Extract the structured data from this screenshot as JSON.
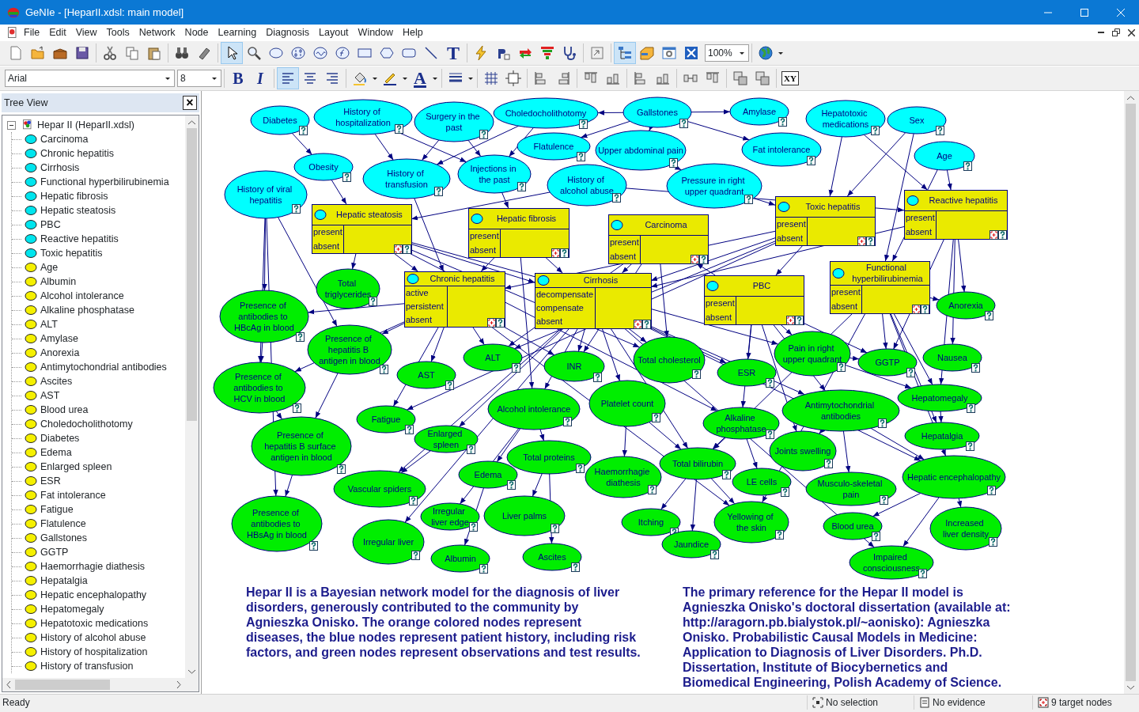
{
  "window": {
    "title": "GeNIe - [HeparII.xdsl: main model]"
  },
  "menu": [
    "File",
    "Edit",
    "View",
    "Tools",
    "Network",
    "Node",
    "Learning",
    "Diagnosis",
    "Layout",
    "Window",
    "Help"
  ],
  "toolbar": {
    "font": "Arial",
    "font_size": "8",
    "zoom": "100%",
    "text_tool": "T",
    "bold": "B",
    "italic": "I",
    "font_color": "A",
    "xy": "XY",
    "pressed": {
      "pointer": true,
      "tree_view": true,
      "align_left": true
    }
  },
  "tree_view": {
    "title": "Tree View",
    "close": "×",
    "root": "Hepar II (HeparII.xdsl)",
    "expanded": true,
    "items": [
      {
        "label": "Carcinoma",
        "kind": "disease"
      },
      {
        "label": "Chronic hepatitis",
        "kind": "disease"
      },
      {
        "label": "Cirrhosis",
        "kind": "disease"
      },
      {
        "label": "Functional hyperbilirubinemia",
        "kind": "disease"
      },
      {
        "label": "Hepatic fibrosis",
        "kind": "disease"
      },
      {
        "label": "Hepatic steatosis",
        "kind": "disease"
      },
      {
        "label": "PBC",
        "kind": "disease"
      },
      {
        "label": "Reactive hepatitis",
        "kind": "disease"
      },
      {
        "label": "Toxic hepatitis",
        "kind": "disease"
      },
      {
        "label": "Age",
        "kind": "variable"
      },
      {
        "label": "Albumin",
        "kind": "variable"
      },
      {
        "label": "Alcohol intolerance",
        "kind": "variable"
      },
      {
        "label": "Alkaline phosphatase",
        "kind": "variable"
      },
      {
        "label": "ALT",
        "kind": "variable"
      },
      {
        "label": "Amylase",
        "kind": "variable"
      },
      {
        "label": "Anorexia",
        "kind": "variable"
      },
      {
        "label": "Antimytochondrial antibodies",
        "kind": "variable"
      },
      {
        "label": "Ascites",
        "kind": "variable"
      },
      {
        "label": "AST",
        "kind": "variable"
      },
      {
        "label": "Blood urea",
        "kind": "variable"
      },
      {
        "label": "Choledocholithotomy",
        "kind": "variable"
      },
      {
        "label": "Diabetes",
        "kind": "variable"
      },
      {
        "label": "Edema",
        "kind": "variable"
      },
      {
        "label": "Enlarged spleen",
        "kind": "variable"
      },
      {
        "label": "ESR",
        "kind": "variable"
      },
      {
        "label": "Fat intolerance",
        "kind": "variable"
      },
      {
        "label": "Fatigue",
        "kind": "variable"
      },
      {
        "label": "Flatulence",
        "kind": "variable"
      },
      {
        "label": "Gallstones",
        "kind": "variable"
      },
      {
        "label": "GGTP",
        "kind": "variable"
      },
      {
        "label": "Haemorrhagie diathesis",
        "kind": "variable"
      },
      {
        "label": "Hepatalgia",
        "kind": "variable"
      },
      {
        "label": "Hepatic encephalopathy",
        "kind": "variable"
      },
      {
        "label": "Hepatomegaly",
        "kind": "variable"
      },
      {
        "label": "Hepatotoxic medications",
        "kind": "variable"
      },
      {
        "label": "History of alcohol abuse",
        "kind": "variable"
      },
      {
        "label": "History of hospitalization",
        "kind": "variable"
      },
      {
        "label": "History of transfusion",
        "kind": "variable"
      }
    ]
  },
  "network": {
    "nodes": [
      {
        "label": "Diabetes",
        "kind": "history"
      },
      {
        "label": "History of\nhospitalization",
        "kind": "history"
      },
      {
        "label": "Surgery in the\npast",
        "kind": "history"
      },
      {
        "label": "Choledocholithotomy",
        "kind": "history"
      },
      {
        "label": "Gallstones",
        "kind": "history"
      },
      {
        "label": "Amylase",
        "kind": "history"
      },
      {
        "label": "Hepatotoxic\nmedications",
        "kind": "history"
      },
      {
        "label": "Sex",
        "kind": "history"
      },
      {
        "label": "Flatulence",
        "kind": "history"
      },
      {
        "label": "Upper abdominal pain",
        "kind": "history"
      },
      {
        "label": "Fat intolerance",
        "kind": "history"
      },
      {
        "label": "Age",
        "kind": "history"
      },
      {
        "label": "Obesity",
        "kind": "history"
      },
      {
        "label": "History of\ntransfusion",
        "kind": "history"
      },
      {
        "label": "Injections in\nthe past",
        "kind": "history"
      },
      {
        "label": "History of\nalcohol abuse",
        "kind": "history"
      },
      {
        "label": "Pressure in right\nupper quadrant",
        "kind": "history"
      },
      {
        "label": "History of viral\nhepatitis",
        "kind": "history"
      },
      {
        "label": "Hepatic steatosis",
        "kind": "disease",
        "target": true,
        "states": [
          "present",
          "absent"
        ]
      },
      {
        "label": "Hepatic fibrosis",
        "kind": "disease",
        "target": true,
        "states": [
          "present",
          "absent"
        ]
      },
      {
        "label": "Carcinoma",
        "kind": "disease",
        "target": true,
        "states": [
          "present",
          "absent"
        ]
      },
      {
        "label": "Toxic hepatitis",
        "kind": "disease",
        "target": true,
        "states": [
          "present",
          "absent"
        ]
      },
      {
        "label": "Reactive hepatitis",
        "kind": "disease",
        "target": true,
        "states": [
          "present",
          "absent"
        ]
      },
      {
        "label": "Presence of\nantibodies to\nHBcAg in blood",
        "kind": "observation"
      },
      {
        "label": "Total\ntriglycerides",
        "kind": "observation"
      },
      {
        "label": "Chronic hepatitis",
        "kind": "disease",
        "target": true,
        "states": [
          "active",
          "persistent",
          "absent"
        ]
      },
      {
        "label": "Cirrhosis",
        "kind": "disease",
        "target": true,
        "states": [
          "decompensate",
          "compensate",
          "absent"
        ]
      },
      {
        "label": "PBC",
        "kind": "disease",
        "target": true,
        "states": [
          "present",
          "absent"
        ]
      },
      {
        "label": "Functional\nhyperbilirubinemia",
        "kind": "disease",
        "target": true,
        "states": [
          "present",
          "absent"
        ]
      },
      {
        "label": "Anorexia",
        "kind": "observation"
      },
      {
        "label": "Presence of\nantibodies to\nHCV in blood",
        "kind": "observation"
      },
      {
        "label": "Presence of\nhepatitis B\nantigen in blood",
        "kind": "observation"
      },
      {
        "label": "AST",
        "kind": "observation"
      },
      {
        "label": "ALT",
        "kind": "observation"
      },
      {
        "label": "INR",
        "kind": "observation"
      },
      {
        "label": "Total cholesterol",
        "kind": "observation"
      },
      {
        "label": "ESR",
        "kind": "observation"
      },
      {
        "label": "Pain in right\nupper quadrant",
        "kind": "observation"
      },
      {
        "label": "GGTP",
        "kind": "observation"
      },
      {
        "label": "Nausea",
        "kind": "observation"
      },
      {
        "label": "Presence of\nhepatitis B surface\nantigen in blood",
        "kind": "observation"
      },
      {
        "label": "Fatigue",
        "kind": "observation"
      },
      {
        "label": "Enlarged\nspleen",
        "kind": "observation"
      },
      {
        "label": "Alcohol intolerance",
        "kind": "observation"
      },
      {
        "label": "Platelet count",
        "kind": "observation"
      },
      {
        "label": "Alkaline\nphosphatase",
        "kind": "observation"
      },
      {
        "label": "Antimytochondrial\nantibodies",
        "kind": "observation"
      },
      {
        "label": "Hepatomegaly",
        "kind": "observation"
      },
      {
        "label": "Hepatalgia",
        "kind": "observation"
      },
      {
        "label": "Vascular spiders",
        "kind": "observation"
      },
      {
        "label": "Edema",
        "kind": "observation"
      },
      {
        "label": "Total proteins",
        "kind": "observation"
      },
      {
        "label": "Haemorrhagie\ndiathesis",
        "kind": "observation"
      },
      {
        "label": "Total bilirubin",
        "kind": "observation"
      },
      {
        "label": "LE cells",
        "kind": "observation"
      },
      {
        "label": "Joints swelling",
        "kind": "observation"
      },
      {
        "label": "Musculo-skeletal\npain",
        "kind": "observation"
      },
      {
        "label": "Hepatic encephalopathy",
        "kind": "observation"
      },
      {
        "label": "Presence of\nantibodies to\nHBsAg in blood",
        "kind": "observation"
      },
      {
        "label": "Irregular liver",
        "kind": "observation"
      },
      {
        "label": "Irregular\nliver edge",
        "kind": "observation"
      },
      {
        "label": "Albumin",
        "kind": "observation"
      },
      {
        "label": "Liver palms",
        "kind": "observation"
      },
      {
        "label": "Ascites",
        "kind": "observation"
      },
      {
        "label": "Itching",
        "kind": "observation"
      },
      {
        "label": "Jaundice",
        "kind": "observation"
      },
      {
        "label": "Yellowing of\nthe skin",
        "kind": "observation"
      },
      {
        "label": "Blood urea",
        "kind": "observation"
      },
      {
        "label": "Impaired\nconsciousness",
        "kind": "observation"
      },
      {
        "label": "Increased\nliver density",
        "kind": "observation"
      }
    ]
  },
  "descriptions": [
    "Hepar II is a Bayesian network model for the diagnosis of liver disorders, generously contributed to the community by Agnieszka Onisko. The orange colored nodes represent diseases, the blue nodes represent patient history, including risk factors, and green nodes represent observations and test results.",
    "The primary reference for the Hepar II model is Agnieszka Onisko's doctoral dissertation (available at: http://aragorn.pb.bialystok.pl/~aonisko): Agnieszka Onisko. Probabilistic Causal Models in Medicine: Application to Diagnosis of Liver Disorders. Ph.D. Dissertation, Institute of Biocybernetics and Biomedical Engineering, Polish Academy of Science."
  ],
  "status_bar": {
    "message": "Ready",
    "selection": "No selection",
    "evidence": "No evidence",
    "targets": "9 target nodes"
  }
}
